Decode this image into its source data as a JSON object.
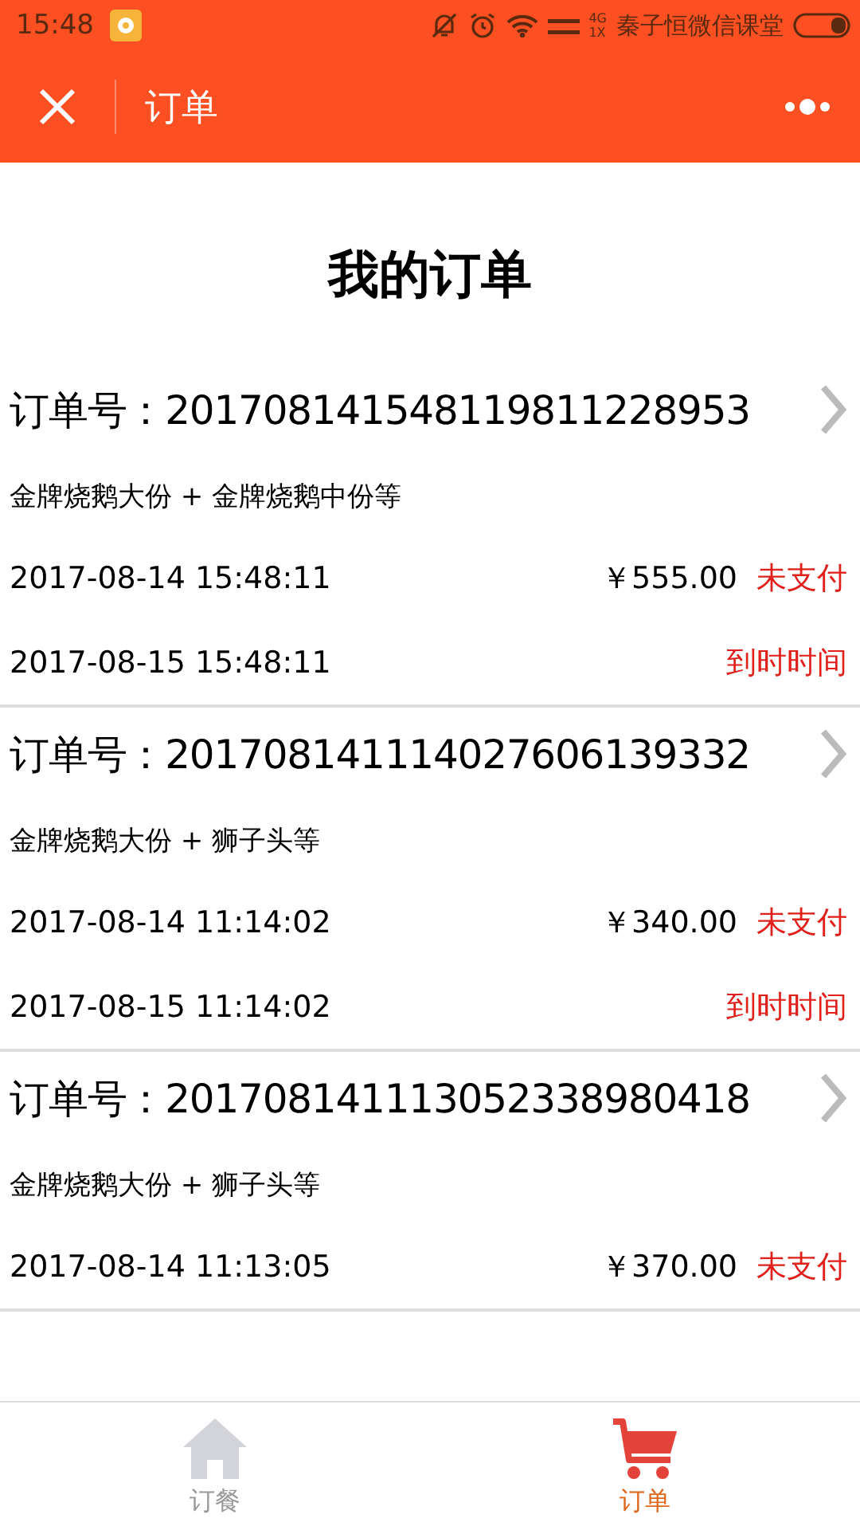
{
  "status_bar": {
    "time": "15:48",
    "network_top": "4G",
    "network_bottom": "1X",
    "carrier": "秦子恒微信课堂"
  },
  "nav_bar": {
    "title": "订单"
  },
  "page_title": "我的订单",
  "orders": [
    {
      "number_label": "订单号：",
      "number": "201708141548119811228953",
      "items": "金牌烧鹅大份 + 金牌烧鹅中份等",
      "created": "2017-08-14 15:48:11",
      "price": "￥555.00",
      "status": "未支付",
      "deadline": "2017-08-15 15:48:11",
      "deadline_label": "到时时间"
    },
    {
      "number_label": "订单号：",
      "number": "201708141114027606139332",
      "items": "金牌烧鹅大份 + 狮子头等",
      "created": "2017-08-14 11:14:02",
      "price": "￥340.00",
      "status": "未支付",
      "deadline": "2017-08-15 11:14:02",
      "deadline_label": "到时时间"
    },
    {
      "number_label": "订单号：",
      "number": "201708141113052338980418",
      "items": "金牌烧鹅大份 + 狮子头等",
      "created": "2017-08-14 11:13:05",
      "price": "￥370.00",
      "status": "未支付"
    }
  ],
  "tabs": [
    {
      "label": "订餐",
      "kind": "home",
      "selected": false
    },
    {
      "label": "订单",
      "kind": "cart",
      "selected": true
    }
  ]
}
